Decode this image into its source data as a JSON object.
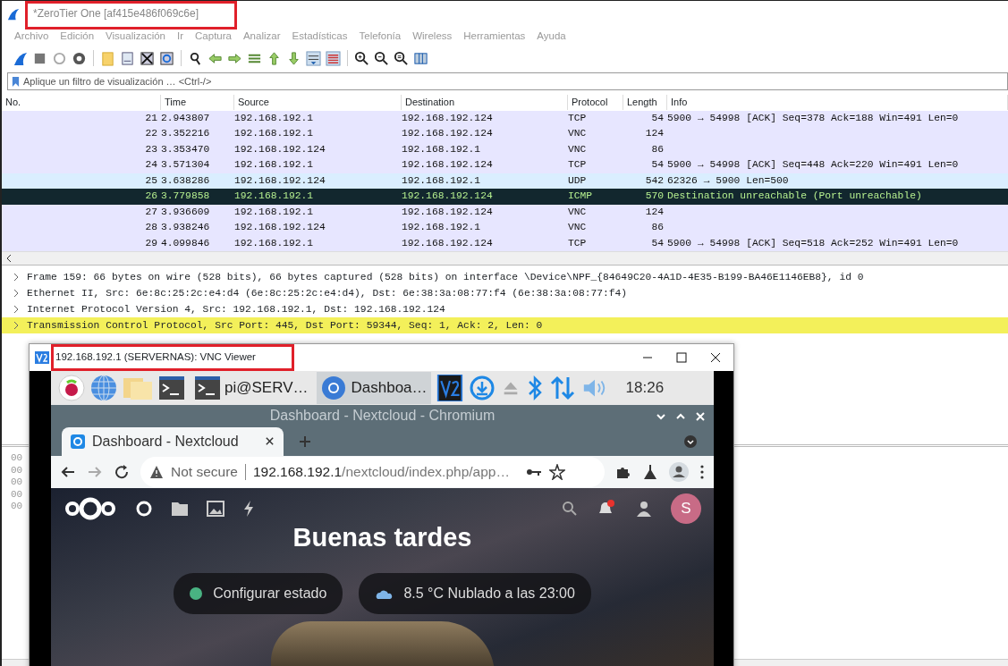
{
  "window": {
    "title": "*ZeroTier One [af415e486f069c6e]",
    "highlighted": true
  },
  "menu": [
    "Archivo",
    "Edición",
    "Visualización",
    "Ir",
    "Captura",
    "Analizar",
    "Estadísticas",
    "Telefonía",
    "Wireless",
    "Herramientas",
    "Ayuda"
  ],
  "filter": {
    "placeholder": "Aplique un filtro de visualización … <Ctrl-/>"
  },
  "packet_list": {
    "columns": [
      "No.",
      "Time",
      "Source",
      "Destination",
      "Protocol",
      "Length",
      "Info"
    ],
    "rows": [
      {
        "no": "21",
        "time": "2.943807",
        "source": "192.168.192.1",
        "destination": "192.168.192.124",
        "protocol": "TCP",
        "length": "54",
        "info": "5900 → 54998 [ACK] Seq=378 Ack=188 Win=491 Len=0",
        "color": "#e7e6ff",
        "selected": false
      },
      {
        "no": "22",
        "time": "3.352216",
        "source": "192.168.192.1",
        "destination": "192.168.192.124",
        "protocol": "VNC",
        "length": "124",
        "info": "",
        "color": "#e7e6ff",
        "selected": false
      },
      {
        "no": "23",
        "time": "3.353470",
        "source": "192.168.192.124",
        "destination": "192.168.192.1",
        "protocol": "VNC",
        "length": "86",
        "info": "",
        "color": "#e7e6ff",
        "selected": false
      },
      {
        "no": "24",
        "time": "3.571304",
        "source": "192.168.192.1",
        "destination": "192.168.192.124",
        "protocol": "TCP",
        "length": "54",
        "info": "5900 → 54998 [ACK] Seq=448 Ack=220 Win=491 Len=0",
        "color": "#e7e6ff",
        "selected": false
      },
      {
        "no": "25",
        "time": "3.638286",
        "source": "192.168.192.124",
        "destination": "192.168.192.1",
        "protocol": "UDP",
        "length": "542",
        "info": "62326 → 5900 Len=500",
        "color": "#daeeff",
        "selected": false
      },
      {
        "no": "26",
        "time": "3.779858",
        "source": "192.168.192.1",
        "destination": "192.168.192.124",
        "protocol": "ICMP",
        "length": "570",
        "info": "Destination unreachable (Port unreachable)",
        "color": "#12272e",
        "selected": true
      },
      {
        "no": "27",
        "time": "3.936609",
        "source": "192.168.192.1",
        "destination": "192.168.192.124",
        "protocol": "VNC",
        "length": "124",
        "info": "",
        "color": "#e7e6ff",
        "selected": false
      },
      {
        "no": "28",
        "time": "3.938246",
        "source": "192.168.192.124",
        "destination": "192.168.192.1",
        "protocol": "VNC",
        "length": "86",
        "info": "",
        "color": "#e7e6ff",
        "selected": false
      },
      {
        "no": "29",
        "time": "4.099846",
        "source": "192.168.192.1",
        "destination": "192.168.192.124",
        "protocol": "TCP",
        "length": "54",
        "info": "5900 → 54998 [ACK] Seq=518 Ack=252 Win=491 Len=0",
        "color": "#e7e6ff",
        "selected": false
      }
    ]
  },
  "details": [
    {
      "text": "Frame 159: 66 bytes on wire (528 bits), 66 bytes captured (528 bits) on interface \\Device\\NPF_{84649C20-4A1D-4E35-B199-BA46E1146EB8}, id 0",
      "expanded": false,
      "selected": false
    },
    {
      "text": "Ethernet II, Src: 6e:8c:25:2c:e4:d4 (6e:8c:25:2c:e4:d4), Dst: 6e:38:3a:08:77:f4 (6e:38:3a:08:77:f4)",
      "expanded": false,
      "selected": false
    },
    {
      "text": "Internet Protocol Version 4, Src: 192.168.192.1, Dst: 192.168.192.124",
      "expanded": false,
      "selected": false
    },
    {
      "text": "Transmission Control Protocol, Src Port: 445, Dst Port: 59344, Seq: 1, Ack: 2, Len: 0",
      "expanded": false,
      "selected": true
    }
  ],
  "hex_rows": [
    "00",
    "00",
    "00",
    "00",
    "00"
  ],
  "vnc": {
    "title": "192.168.192.1 (SERVERNAS): VNC Viewer",
    "highlighted": true,
    "taskbar": {
      "windows": [
        {
          "label": "pi@SERV…",
          "selected": false
        },
        {
          "label": "Dashboa…",
          "selected": true
        }
      ],
      "clock": "18:26"
    },
    "browser": {
      "window_title": "Dashboard - Nextcloud - Chromium",
      "tabs": [
        {
          "label": "Dashboard - Nextcloud",
          "selected": true
        }
      ],
      "security": "Not secure",
      "url_host": "192.168.192.1",
      "url_path": "/nextcloud/index.php/app…",
      "page": {
        "greeting": "Buenas tardes",
        "avatar": "S",
        "status": "Configurar estado",
        "weather": "8.5 °C Nublado a las 23:00"
      }
    }
  }
}
